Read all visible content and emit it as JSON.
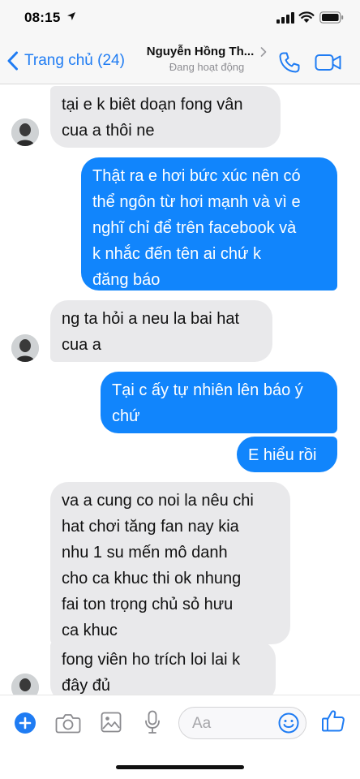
{
  "status_bar": {
    "time": "08:15",
    "icons": [
      "location-arrow-icon",
      "signal-bars-icon",
      "wifi-icon",
      "battery-icon"
    ]
  },
  "nav": {
    "back_label": "Trang chủ (24)",
    "contact_name": "Nguyễn Hồng Th...",
    "contact_status": "Đang hoạt động",
    "icons": [
      "back-chevron-icon",
      "chevron-right-icon",
      "phone-icon",
      "video-camera-icon"
    ]
  },
  "messages": [
    {
      "side": "in",
      "text": "tại e k biêt doạn fong vân\ncua a thôi ne"
    },
    {
      "side": "out",
      "text": "Thật ra e hơi bức xúc nên có\nthể ngôn từ hơi mạnh và vì e\nnghĩ chỉ để trên facebook và\nk nhắc đến tên ai chứ k\nđăng báo"
    },
    {
      "side": "in",
      "text": "ng ta hỏi a neu la bai hat\ncua a"
    },
    {
      "side": "out",
      "text": "Tại c ấy tự nhiên lên báo ý\nchứ"
    },
    {
      "side": "out",
      "text": "E hiểu rồi"
    },
    {
      "side": "in",
      "text": "va a cung co noi la nêu chi\nhat chơi tăng fan nay kia\nnhu 1 su mến mô danh\ncho ca khuc thi ok nhung\nfai ton trọng chủ sỏ hưu\nca khuc"
    },
    {
      "side": "in",
      "text": "fong viên ho trích loi lai k\nđây đủ"
    }
  ],
  "composer": {
    "placeholder": "Aa",
    "icons": [
      "plus-icon",
      "camera-icon",
      "photo-icon",
      "microphone-icon",
      "emoji-icon",
      "thumbs-up-icon"
    ]
  },
  "colors": {
    "accent": "#1f7cf3",
    "outgoing_bubble": "#1185fc",
    "incoming_bubble": "#e9e9eb",
    "bar_background": "#f7f7f7"
  }
}
